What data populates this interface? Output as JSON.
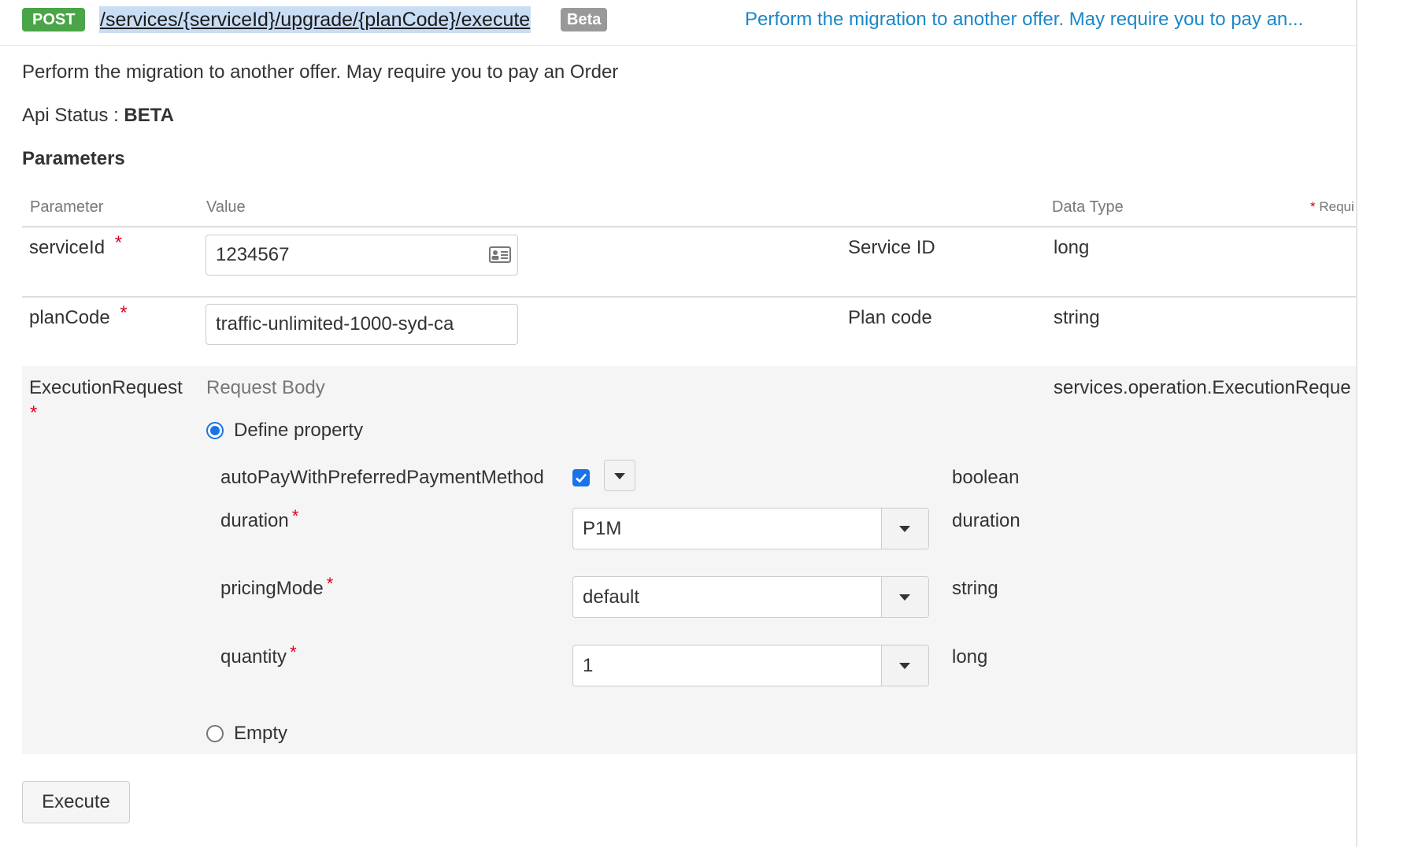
{
  "header": {
    "method": "POST",
    "path": "/services/{serviceId}/upgrade/{planCode}/execute",
    "badge": "Beta",
    "summary": "Perform the migration to another offer. May require you to pay an..."
  },
  "description": "Perform the migration to another offer. May require you to pay an Order",
  "api_status": {
    "label": "Api Status :",
    "value": "BETA"
  },
  "parameters_heading": "Parameters",
  "table": {
    "headers": {
      "parameter": "Parameter",
      "value": "Value",
      "data_type": "Data Type",
      "required_note": "Requi"
    },
    "required_marker": "*",
    "rows": [
      {
        "name": "serviceId",
        "value": "1234567",
        "description": "Service ID",
        "data_type": "long"
      },
      {
        "name": "planCode",
        "value": "traffic-unlimited-1000-syd-ca",
        "description": "Plan code",
        "data_type": "string"
      },
      {
        "name": "ExecutionRequest",
        "value_label": "Request Body",
        "data_type": "services.operation.ExecutionReque"
      }
    ]
  },
  "request_body": {
    "define_property_label": "Define property",
    "define_property_selected": true,
    "empty_label": "Empty",
    "empty_selected": false,
    "properties": [
      {
        "name": "autoPayWithPreferredPaymentMethod",
        "required": false,
        "checked": true,
        "type": "boolean"
      },
      {
        "name": "duration",
        "required": true,
        "value": "P1M",
        "type": "duration"
      },
      {
        "name": "pricingMode",
        "required": true,
        "value": "default",
        "type": "string"
      },
      {
        "name": "quantity",
        "required": true,
        "value": "1",
        "type": "long"
      }
    ]
  },
  "execute_label": "Execute",
  "colors": {
    "method_badge": "#49a547",
    "beta_badge": "#999999",
    "summary_link": "#1b87c7",
    "required_star": "#d9001b",
    "accent": "#1a73e8",
    "body_row_bg": "#f5f5f5"
  },
  "icons": {
    "value_field": "contact-card-icon",
    "dropdown": "caret-down-icon"
  }
}
